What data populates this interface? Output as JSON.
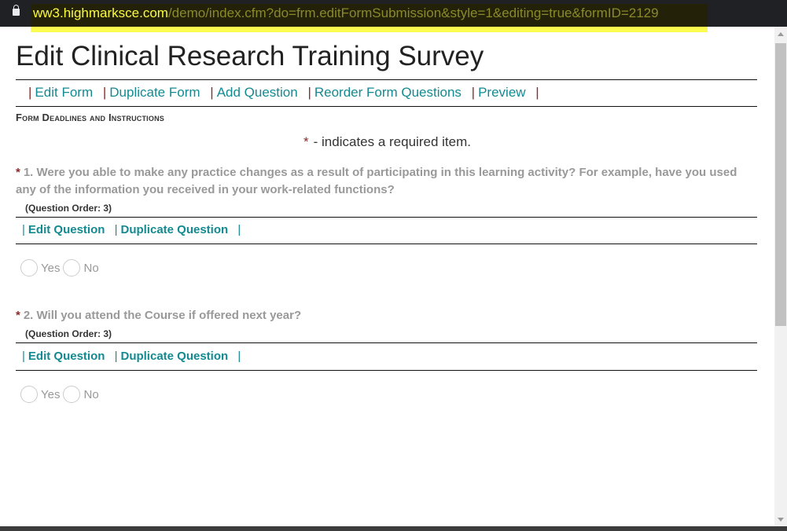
{
  "browser": {
    "url_domain": "ww3.highmarksce.com",
    "url_path": "/demo/index.cfm?do=frm.editFormSubmission&style=1&editing=true&formID=2129"
  },
  "page": {
    "title": "Edit Clinical Research Training Survey"
  },
  "nav": {
    "separator": "|",
    "items": [
      "Edit Form",
      "Duplicate Form",
      "Add Question",
      "Reorder Form Questions",
      "Preview"
    ]
  },
  "section_title": "Form Deadlines and Instructions",
  "required_note": {
    "star": "*",
    "text": "- indicates a required item."
  },
  "questions": [
    {
      "star": "*",
      "text": "1.  Were you able to make any practice changes as a result of participating in this learning activity? For example, have you used any of the information you received in your work-related functions?",
      "order": "(Question Order: 3)",
      "edit": "Edit Question",
      "duplicate": "Duplicate Question",
      "options": [
        "Yes",
        "No"
      ]
    },
    {
      "star": "*",
      "text": "2.  Will you attend the Course if offered next year?",
      "order": "(Question Order: 3)",
      "edit": "Edit Question",
      "duplicate": "Duplicate Question",
      "options": [
        "Yes",
        "No"
      ]
    }
  ]
}
